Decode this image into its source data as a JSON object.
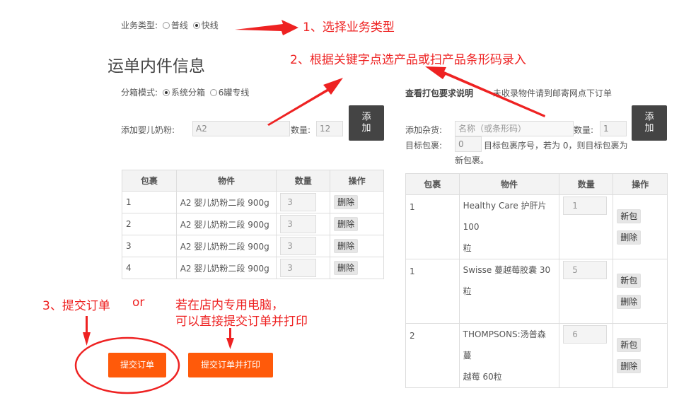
{
  "biz_type": {
    "label": "业务类型:",
    "options": [
      "普线",
      "快线"
    ],
    "selected": 1
  },
  "section_title": "运单内件信息",
  "box_mode": {
    "label": "分箱模式:",
    "options": [
      "系统分箱",
      "6罐专线"
    ],
    "selected": 0
  },
  "add_milk": {
    "label": "添加婴儿奶粉:",
    "value": "A2",
    "qty_label": "数量:",
    "qty_value": "12",
    "button": "添\n加"
  },
  "right_header": {
    "link": "查看打包要求说明",
    "note": "未收录物件请到邮寄网点下订单"
  },
  "add_misc": {
    "label": "添加杂货:",
    "placeholder": "名称（或条形码）",
    "qty_label": "数量:",
    "qty_value": "1",
    "button": "添\n加",
    "target_label": "目标包裹:",
    "target_value": "0",
    "target_desc_line1": "目标包裹序号，若为 0，则目标包裹为",
    "target_desc_line2": "新包裹。"
  },
  "left_table": {
    "headers": [
      "包裹",
      "物件",
      "数量",
      "操作"
    ],
    "rows": [
      {
        "pkg": "1",
        "item": "A2 婴儿奶粉二段 900g",
        "qty": "3",
        "action": "删除"
      },
      {
        "pkg": "2",
        "item": "A2 婴儿奶粉二段 900g",
        "qty": "3",
        "action": "删除"
      },
      {
        "pkg": "3",
        "item": "A2 婴儿奶粉二段 900g",
        "qty": "3",
        "action": "删除"
      },
      {
        "pkg": "4",
        "item": "A2 婴儿奶粉二段 900g",
        "qty": "3",
        "action": "删除"
      }
    ]
  },
  "right_table": {
    "headers": [
      "包裹",
      "物件",
      "数量",
      "操作"
    ],
    "rows": [
      {
        "pkg": "1",
        "item_l1": "Healthy Care 护肝片 100",
        "item_l2": "粒",
        "qty": "1",
        "action1": "新包",
        "action2": "删除"
      },
      {
        "pkg": "1",
        "item_l1": "Swisse 蔓越莓胶囊 30粒",
        "item_l2": "",
        "qty": "5",
        "action1": "新包",
        "action2": "删除"
      },
      {
        "pkg": "2",
        "item_l1": "THOMPSONS:汤普森 蔓",
        "item_l2": "越莓 60粒",
        "qty": "6",
        "action1": "新包",
        "action2": "删除"
      }
    ]
  },
  "buttons": {
    "submit": "提交订单",
    "submit_print": "提交订单并打印"
  },
  "annotations": {
    "step1": "1、选择业务类型",
    "step2": "2、根据关键字点选产品或扫产品条形码录入",
    "step3": "3、提交订单",
    "or": "or",
    "store_line1": "若在店内专用电脑，",
    "store_line2": "可以直接提交订单并打印"
  },
  "colors": {
    "accent_orange": "#ff5a0a",
    "annotation_red": "#ee2222",
    "dark_button": "#444444"
  }
}
